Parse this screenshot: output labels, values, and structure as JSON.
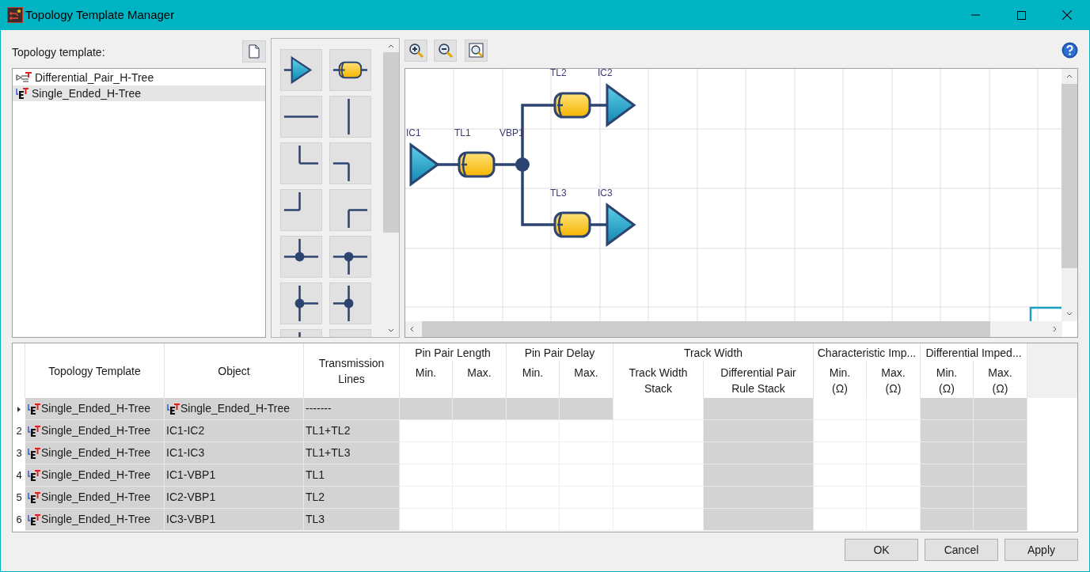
{
  "window": {
    "title": "Topology Template Manager"
  },
  "templates": {
    "label": "Topology template:",
    "items": [
      {
        "label": "Differential_Pair_H-Tree",
        "kind": "differential",
        "selected": false
      },
      {
        "label": "Single_Ended_H-Tree",
        "kind": "single",
        "selected": true
      }
    ]
  },
  "palette": [
    {
      "kind": "buffer"
    },
    {
      "kind": "cylinder"
    },
    {
      "kind": "hline"
    },
    {
      "kind": "vline"
    },
    {
      "kind": "corner-up-right"
    },
    {
      "kind": "corner-left-down"
    },
    {
      "kind": "corner-up-left"
    },
    {
      "kind": "corner-right-down"
    },
    {
      "kind": "tee-up"
    },
    {
      "kind": "tee-down"
    },
    {
      "kind": "tee-right"
    },
    {
      "kind": "tee-left"
    },
    {
      "kind": "vline"
    },
    {
      "kind": "hline"
    }
  ],
  "diagram": {
    "nodes": [
      {
        "label": "IC1",
        "kind": "buffer"
      },
      {
        "label": "TL1",
        "kind": "line"
      },
      {
        "label": "VBP1",
        "kind": "via"
      },
      {
        "label": "TL2",
        "kind": "line"
      },
      {
        "label": "IC2",
        "kind": "buffer"
      },
      {
        "label": "TL3",
        "kind": "line"
      },
      {
        "label": "IC3",
        "kind": "buffer"
      }
    ]
  },
  "table": {
    "columns": [
      {
        "label": "Topology Template"
      },
      {
        "label": "Object"
      },
      {
        "label": "Transmission\nLines"
      },
      {
        "label": "Pin Pair Length",
        "sub": [
          "Min.",
          "Max."
        ]
      },
      {
        "label": "Pin Pair Delay",
        "sub": [
          "Min.",
          "Max."
        ]
      },
      {
        "label": "Track Width",
        "sub": [
          "Track Width\nStack",
          "Differential Pair\nRule Stack"
        ]
      },
      {
        "label": "Characteristic Imp...",
        "sub": [
          "Min.\n(Ω)",
          "Max.\n(Ω)"
        ]
      },
      {
        "label": "Differential Imped...",
        "sub": [
          "Min.\n(Ω)",
          "Max.\n(Ω)"
        ]
      }
    ],
    "rows": [
      {
        "current": true,
        "cells": [
          {
            "text": "Single_Ended_H-Tree",
            "kind": "template",
            "disabled": true
          },
          {
            "text": "Single_Ended_H-Tree",
            "kind": "template",
            "disabled": true
          },
          {
            "text": "-------",
            "kind": "text",
            "disabled": true
          },
          {
            "disabled": true
          },
          {
            "disabled": true
          },
          {
            "disabled": true
          },
          {
            "disabled": true
          },
          {
            "disabled": false
          },
          {
            "disabled": true
          },
          {
            "disabled": false
          },
          {
            "disabled": false
          },
          {
            "disabled": true
          },
          {
            "disabled": true
          }
        ]
      },
      {
        "current": false,
        "number": "2",
        "cells": [
          {
            "text": "Single_Ended_H-Tree",
            "kind": "template",
            "disabled": true
          },
          {
            "text": "IC1-IC2",
            "kind": "text",
            "disabled": true
          },
          {
            "text": "TL1+TL2",
            "kind": "text",
            "disabled": true
          },
          {
            "disabled": false
          },
          {
            "disabled": false
          },
          {
            "disabled": false
          },
          {
            "disabled": false
          },
          {
            "disabled": false
          },
          {
            "disabled": true
          },
          {
            "disabled": false
          },
          {
            "disabled": false
          },
          {
            "disabled": true
          },
          {
            "disabled": true
          }
        ]
      },
      {
        "current": false,
        "number": "3",
        "cells": [
          {
            "text": "Single_Ended_H-Tree",
            "kind": "template",
            "disabled": true
          },
          {
            "text": "IC1-IC3",
            "kind": "text",
            "disabled": true
          },
          {
            "text": "TL1+TL3",
            "kind": "text",
            "disabled": true
          },
          {
            "disabled": false
          },
          {
            "disabled": false
          },
          {
            "disabled": false
          },
          {
            "disabled": false
          },
          {
            "disabled": false
          },
          {
            "disabled": true
          },
          {
            "disabled": false
          },
          {
            "disabled": false
          },
          {
            "disabled": true
          },
          {
            "disabled": true
          }
        ]
      },
      {
        "current": false,
        "number": "4",
        "cells": [
          {
            "text": "Single_Ended_H-Tree",
            "kind": "template",
            "disabled": true
          },
          {
            "text": "IC1-VBP1",
            "kind": "text",
            "disabled": true
          },
          {
            "text": "TL1",
            "kind": "text",
            "disabled": true
          },
          {
            "disabled": false
          },
          {
            "disabled": false
          },
          {
            "disabled": false
          },
          {
            "disabled": false
          },
          {
            "disabled": false
          },
          {
            "disabled": true
          },
          {
            "disabled": false
          },
          {
            "disabled": false
          },
          {
            "disabled": true
          },
          {
            "disabled": true
          }
        ]
      },
      {
        "current": false,
        "number": "5",
        "cells": [
          {
            "text": "Single_Ended_H-Tree",
            "kind": "template",
            "disabled": true
          },
          {
            "text": "IC2-VBP1",
            "kind": "text",
            "disabled": true
          },
          {
            "text": "TL2",
            "kind": "text",
            "disabled": true
          },
          {
            "disabled": false
          },
          {
            "disabled": false
          },
          {
            "disabled": false
          },
          {
            "disabled": false
          },
          {
            "disabled": false
          },
          {
            "disabled": true
          },
          {
            "disabled": false
          },
          {
            "disabled": false
          },
          {
            "disabled": true
          },
          {
            "disabled": true
          }
        ]
      },
      {
        "current": false,
        "number": "6",
        "cells": [
          {
            "text": "Single_Ended_H-Tree",
            "kind": "template",
            "disabled": true
          },
          {
            "text": "IC3-VBP1",
            "kind": "text",
            "disabled": true
          },
          {
            "text": "TL3",
            "kind": "text",
            "disabled": true
          },
          {
            "disabled": false
          },
          {
            "disabled": false
          },
          {
            "disabled": false
          },
          {
            "disabled": false
          },
          {
            "disabled": false
          },
          {
            "disabled": true
          },
          {
            "disabled": false
          },
          {
            "disabled": false
          },
          {
            "disabled": true
          },
          {
            "disabled": true
          }
        ]
      }
    ]
  },
  "buttons": [
    "OK",
    "Cancel",
    "Apply"
  ]
}
